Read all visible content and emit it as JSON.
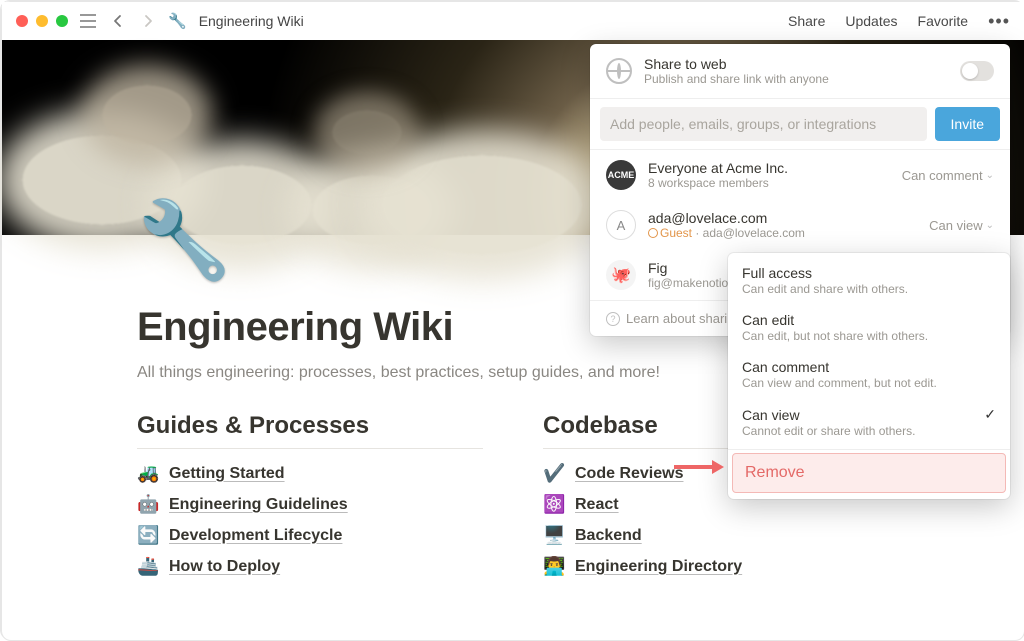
{
  "window": {
    "title": "Engineering Wiki"
  },
  "topnav": {
    "share": "Share",
    "updates": "Updates",
    "favorite": "Favorite"
  },
  "page": {
    "icon": "🔧",
    "title": "Engineering Wiki",
    "subtitle": "All things engineering: processes, best practices, setup guides, and more!"
  },
  "columns": [
    {
      "heading": "Guides & Processes",
      "items": [
        {
          "emoji": "🚜",
          "label": "Getting Started"
        },
        {
          "emoji": "🤖",
          "label": "Engineering Guidelines"
        },
        {
          "emoji": "🔄",
          "label": "Development Lifecycle"
        },
        {
          "emoji": "🚢",
          "label": "How to Deploy"
        }
      ]
    },
    {
      "heading": "Codebase",
      "items": [
        {
          "emoji": "✔️",
          "label": "Code Reviews"
        },
        {
          "emoji": "⚛️",
          "label": "React"
        },
        {
          "emoji": "🖥️",
          "label": "Backend"
        },
        {
          "emoji": "👨‍💻",
          "label": "Engineering Directory"
        }
      ]
    }
  ],
  "share": {
    "web_title": "Share to web",
    "web_sub": "Publish and share link with anyone",
    "search_placeholder": "Add people, emails, groups, or integrations",
    "invite": "Invite",
    "members": [
      {
        "avatar_type": "acme",
        "avatar_text": "ACME",
        "name": "Everyone at Acme Inc.",
        "sub": "8 workspace members",
        "perm": "Can comment",
        "guest": false
      },
      {
        "avatar_type": "letter",
        "avatar_text": "A",
        "name": "ada@lovelace.com",
        "sub": "Guest · ada@lovelace.com",
        "perm": "Can view",
        "guest": true
      },
      {
        "avatar_type": "fig",
        "avatar_text": "🐙",
        "name": "Fig",
        "sub": "fig@makenotio",
        "perm": "",
        "guest": false
      }
    ],
    "learn": "Learn about sharin"
  },
  "dropdown": {
    "items": [
      {
        "title": "Full access",
        "sub": "Can edit and share with others.",
        "selected": false
      },
      {
        "title": "Can edit",
        "sub": "Can edit, but not share with others.",
        "selected": false
      },
      {
        "title": "Can comment",
        "sub": "Can view and comment, but not edit.",
        "selected": false
      },
      {
        "title": "Can view",
        "sub": "Cannot edit or share with others.",
        "selected": true
      }
    ],
    "remove": "Remove"
  }
}
